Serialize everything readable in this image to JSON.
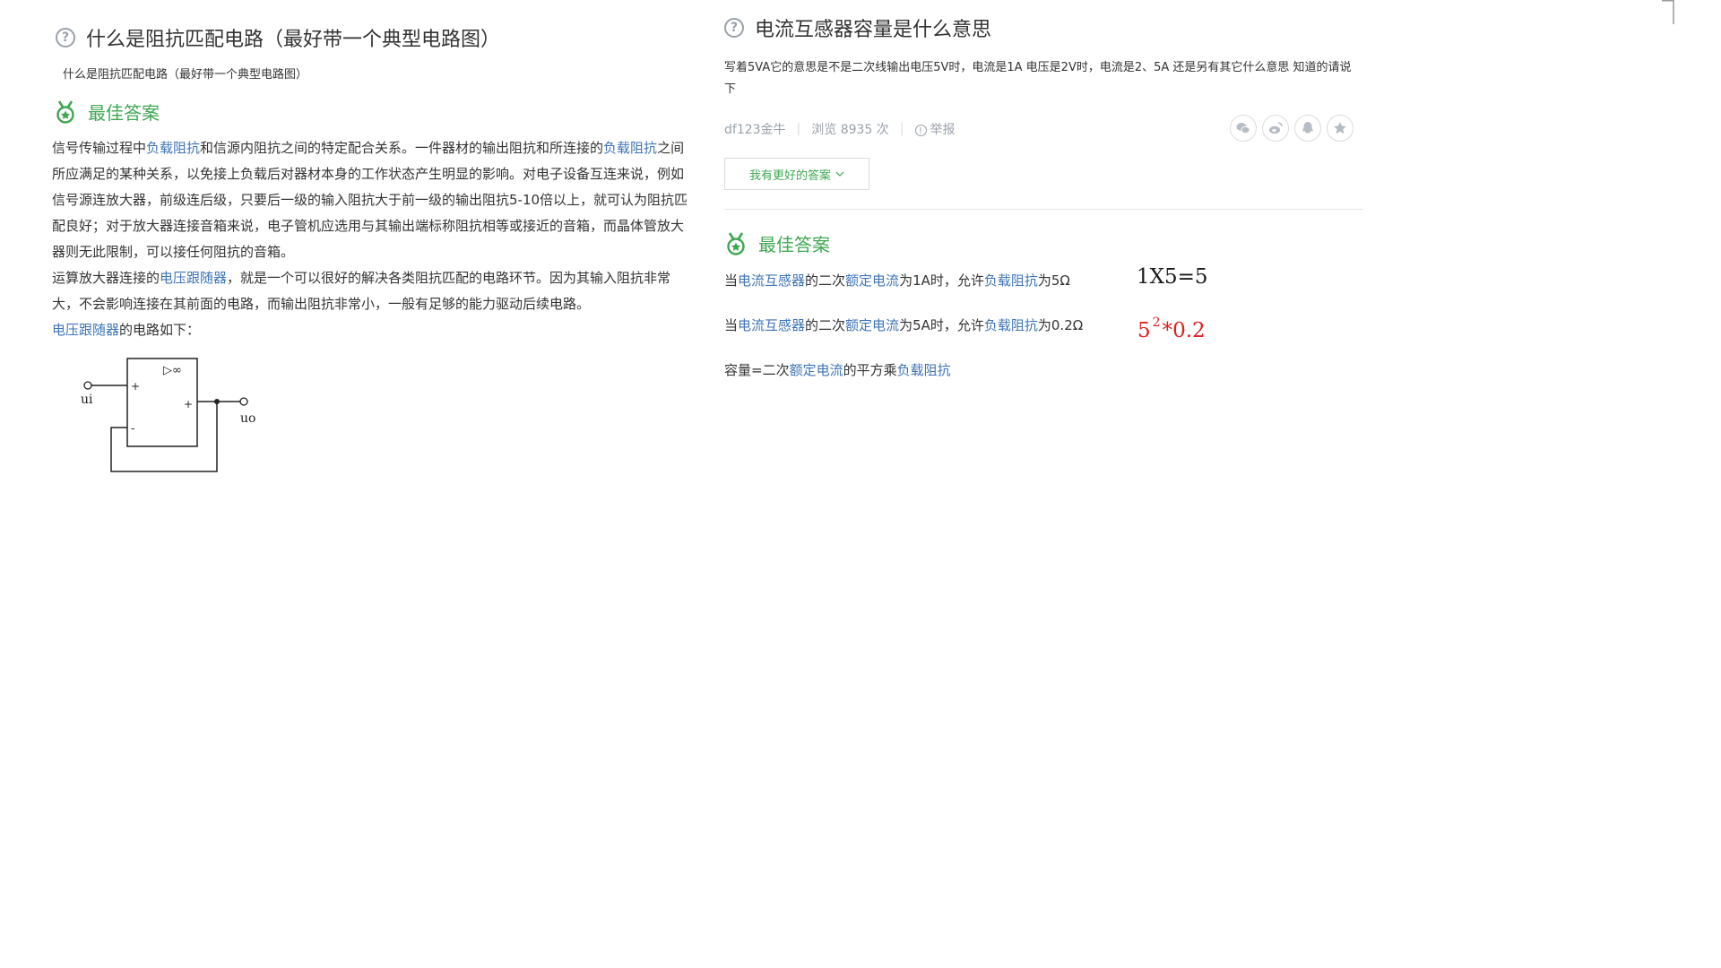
{
  "left": {
    "title": "什么是阻抗匹配电路（最好带一个典型电路图）",
    "description": "什么是阻抗匹配电路（最好带一个典型电路图）",
    "best_answer_label": "最佳答案",
    "answer": {
      "p1_a": "信号传输过程中",
      "link_load_impedance_1": "负载阻抗",
      "p1_b": "和信源内阻抗之间的特定配合关系。一件器材的输出阻抗和所连接的",
      "link_load_impedance_2": "负载阻抗",
      "p1_c": "之间所应满足的某种关系，以免接上负载后对器材本身的工作状态产生明显的影响。对电子设备互连来说，例如信号源连放大器，前级连后级，只要后一级的输入阻抗大于前一级的输出阻抗5-10倍以上，就可认为阻抗匹配良好；对于放大器连接音箱来说，电子管机应选用与其输出端标称阻抗相等或接近的音箱，而晶体管放大器则无此限制，可以接任何阻抗的音箱。",
      "p2_a": "运算放大器连接的",
      "link_voltage_follower_1": "电压跟随器",
      "p2_b": "，就是一个可以很好的解决各类阻抗匹配的电路环节。因为其输入阻抗非常大，不会影响连接在其前面的电路，而输出阻抗非常小，一般有足够的能力驱动后续电路。",
      "link_voltage_follower_2": "电压跟随器",
      "p3": "的电路如下："
    },
    "circuit": {
      "amp_symbol": "▷∞",
      "plus_in": "+",
      "minus_in": "-",
      "plus_out": "+",
      "ui": "ui",
      "uo": "uo"
    }
  },
  "right": {
    "title": "电流互感器容量是什么意思",
    "description": "写着5VA它的意思是不是二次线输出电压5V时，电流是1A 电压是2V时，电流是2、5A 还是另有其它什么意思 知道的请说下",
    "meta": {
      "user": "df123金牛",
      "views": "浏览 8935 次",
      "report": "举报"
    },
    "share_icons": [
      "wechat-icon",
      "weibo-icon",
      "qq-icon",
      "favorite-icon"
    ],
    "better_answer_button": "我有更好的答案",
    "best_answer_label": "最佳答案",
    "answer": {
      "l1_a": "当",
      "l1_link_ct": "电流互感器",
      "l1_b": "的二次",
      "l1_link_rated": "额定电流",
      "l1_c": "为1A时，允许",
      "l1_link_load": "负载阻抗",
      "l1_d": "为5Ω",
      "l2_a": "当",
      "l2_link_ct": "电流互感器",
      "l2_b": "的二次",
      "l2_link_rated": "额定电流",
      "l2_c": "为5A时，允许",
      "l2_link_load": "负载阻抗",
      "l2_d": "为0.2Ω",
      "l3_a": "容量=二次",
      "l3_link_rated": "额定电流",
      "l3_b": "的平方乘",
      "l3_link_load": "负载阻抗"
    },
    "handwritten": {
      "h1": "1X5=5",
      "h2_base": "5",
      "h2_exp": "2",
      "h2_rest": "*0.2"
    }
  },
  "colors": {
    "accent_green": "#3fa752",
    "link_blue": "#3e74b6",
    "muted_gray": "#9aa1aa",
    "handwriting_red": "#e02020"
  }
}
